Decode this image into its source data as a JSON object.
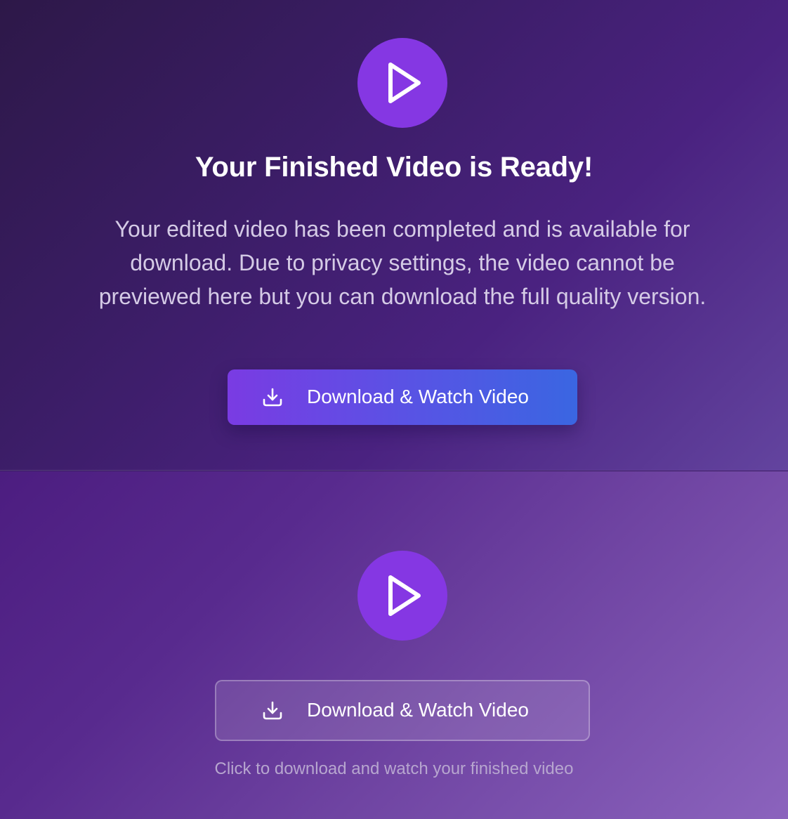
{
  "top_section": {
    "play_icon": "play-icon",
    "title": "Your Finished Video is Ready!",
    "description": "Your edited video has been completed and is available for download. Due to privacy settings, the video cannot be previewed here but you can download the full quality version.",
    "download_button": {
      "label": "Download & Watch Video",
      "icon": "download-icon"
    }
  },
  "bottom_section": {
    "play_icon": "play-icon",
    "download_button": {
      "label": "Download & Watch Video",
      "icon": "download-icon"
    },
    "helper_text": "Click to download and watch your finished video"
  },
  "colors": {
    "accent_purple": "#8537e3",
    "button_gradient_start": "#7a3be3",
    "button_gradient_end": "#3a66e2",
    "title_text": "#ffffff",
    "body_text": "#d5cbe6"
  }
}
